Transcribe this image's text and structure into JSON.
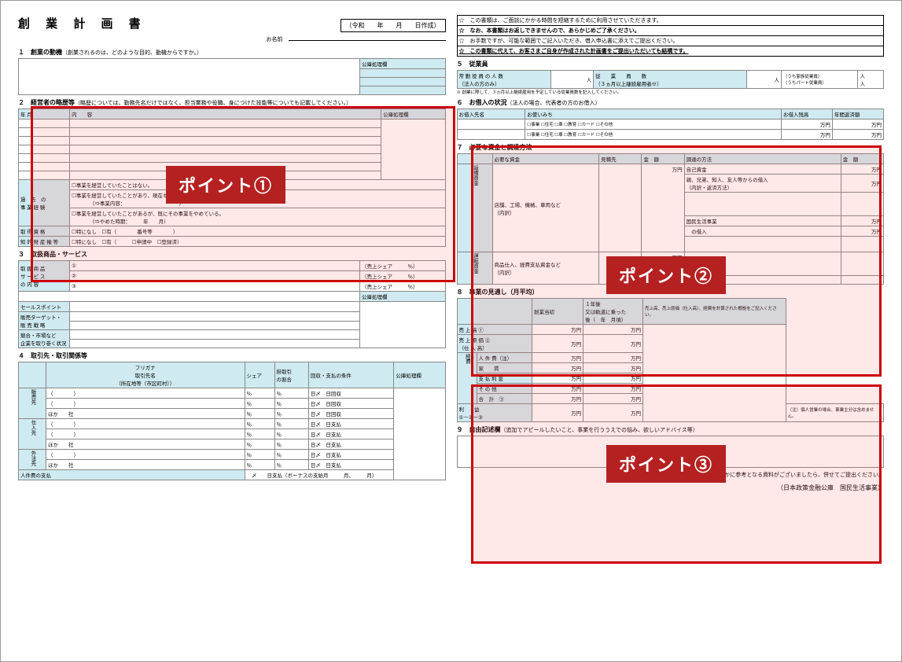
{
  "title": "創 業 計 画 書",
  "date_prefix": "（令和　　年　　月　　日作成）",
  "name_label": "お名前",
  "sec1": {
    "num": "１",
    "t": "創業の動機",
    "sub": "（創業されるのは、どのような目的、動機からですか。）",
    "right": "公庫処理欄"
  },
  "sec2": {
    "num": "２",
    "t": "経営者の略歴等",
    "sub": "（略歴については、勤務先名だけではなく、担当業務や役職、身につけた技能等についても記載してください。）",
    "cols": [
      "年 月",
      "内　　容",
      "公庫処理欄"
    ],
    "row_exp_label": "過　去　の\n事 業 経 験",
    "chk1": "事業を経営していたことはない。",
    "chk2": "事業を経営していたことがあり、現在もその事業を続けている。",
    "chk2sub": "（⇒事業内容：　　　　　　　　　　　）",
    "chk3": "事業を経営していたことがあるが、既にその事業をやめている。",
    "chk3sub": "（⇒やめた時期：　　　年　　月）",
    "r1": "取 得 資 格",
    "r1a": "特になし",
    "r1b": "有（",
    "r1c": "番号等",
    "r2": "知 的 財 産 権 等",
    "r2a": "特になし",
    "r2b": "有（",
    "r2c": "申請中",
    "r2d": "登録済"
  },
  "sec3": {
    "num": "３",
    "t": "取扱商品・サービス",
    "r1": "取 扱 商 品\nサ ー ビ ス\nの 内 容",
    "share": "（売上シェア　　　％）",
    "r2": "セールスポイント",
    "r3": "販売ターゲット・\n販 売 戦 略",
    "r4": "競合・市場など\n企業を取り巻く状況",
    "right": "公庫処理欄"
  },
  "sec4": {
    "num": "４",
    "t": "取引先・取引関係等",
    "hdr": [
      "フリガナ\n取引先名\n（所在地等（市区町村））",
      "シェア",
      "掛取引\nの割合",
      "回収・支払の条件",
      "公庫処理欄"
    ],
    "side": [
      "販売先",
      "仕入先",
      "外注先"
    ],
    "pat_pr": "％",
    "pat_d": "日〆",
    "pat_r": "日回収",
    "pat_p": "日支払",
    "hoka": "ほか　　社",
    "last": "人件費の支払",
    "last2": "日支払（ボーナスの支給月　　　月、　　　月）"
  },
  "starbox": {
    "l1": "☆　この書類は、ご面談にかかる時間を短縮するために利用させていただきます。",
    "l2": "☆　なお、本書類はお返しできませんので、あらかじめご了承ください。",
    "l3": "☆　お手数ですが、可能な範囲でご記入いただき、借入申込書に添えてご提出ください。",
    "l4": "☆　この書類に代えて、お客さまご自身が作成された計画書をご提出いただいても結構です。"
  },
  "sec5": {
    "num": "５",
    "t": "従業員",
    "c1": "常 勤 役 員 の 人 数\n（法人の方のみ）",
    "u": "人",
    "c2": "従　　業　　員　　数\n（３ヵ月以上継続雇用者※）",
    "r1": "（うち家族従業員）",
    "r2": "（うちパート従業員）",
    "note": "※ 創業に際して、３ヵ月以上継続雇用を予定している従業員数を記入してください。"
  },
  "sec6": {
    "num": "６",
    "t": "お借入の状況",
    "sub": "（法人の場合、代表者の方のお借入）",
    "h": [
      "お借入先名",
      "お使いみち",
      "お借入残高",
      "年間返済額"
    ],
    "opts": [
      "事業",
      "住宅",
      "車",
      "教育",
      "カード",
      "その他"
    ],
    "u": "万円"
  },
  "sec7": {
    "num": "７",
    "t": "必要な資金と調達方法",
    "lh": [
      "必要な資金",
      "見積先",
      "金　額"
    ],
    "rh": [
      "調達の方法",
      "金　額"
    ],
    "rs1": "設備資金",
    "rs2": "運転資金",
    "l1": "店舗、工場、機械、車両など",
    "sub": "（内訳）",
    "l2": "商品仕入、経費支払資金など",
    "r1": "自己資金",
    "r2": "親、兄弟、知人、友人等からの借入",
    "r2s": "（内訳・返済方法）",
    "r3": "国民生活事業",
    "r4": "の借入",
    "u": "万円"
  },
  "sec8": {
    "num": "８",
    "t": "事業の見通し（月平均）",
    "h1": "創業当初",
    "h2": "１年後\n又は軌道に乗った\n後（　年　月頃）",
    "h3": "売上高、売上原価（仕入高）、経費を計算された根拠をご記入ください。",
    "rows": [
      "売 上 高 ①",
      "売 上 原 価 ②\n（仕 入 高）",
      "人 件 費（注）",
      "家　　賃",
      "支 払 利 息",
      "そ の 他",
      "合　計　③",
      "利　　益\n①－②－③"
    ],
    "side": "経費",
    "u": "万円",
    "note": "（注）個人営業の場合、事業主分は含めません。"
  },
  "sec9": {
    "num": "９",
    "t": "自由記述欄",
    "sub": "（追加でアピールしたいこと、事業を行ううえでの悩み、欲しいアドバイス等）"
  },
  "footnote": "ほかに参考となる資料がございましたら、併せてご提出ください。",
  "footer": "（日本政策金融公庫　国民生活事業）",
  "points": {
    "p1": "ポイント①",
    "p2": "ポイント②",
    "p3": "ポイント③"
  }
}
